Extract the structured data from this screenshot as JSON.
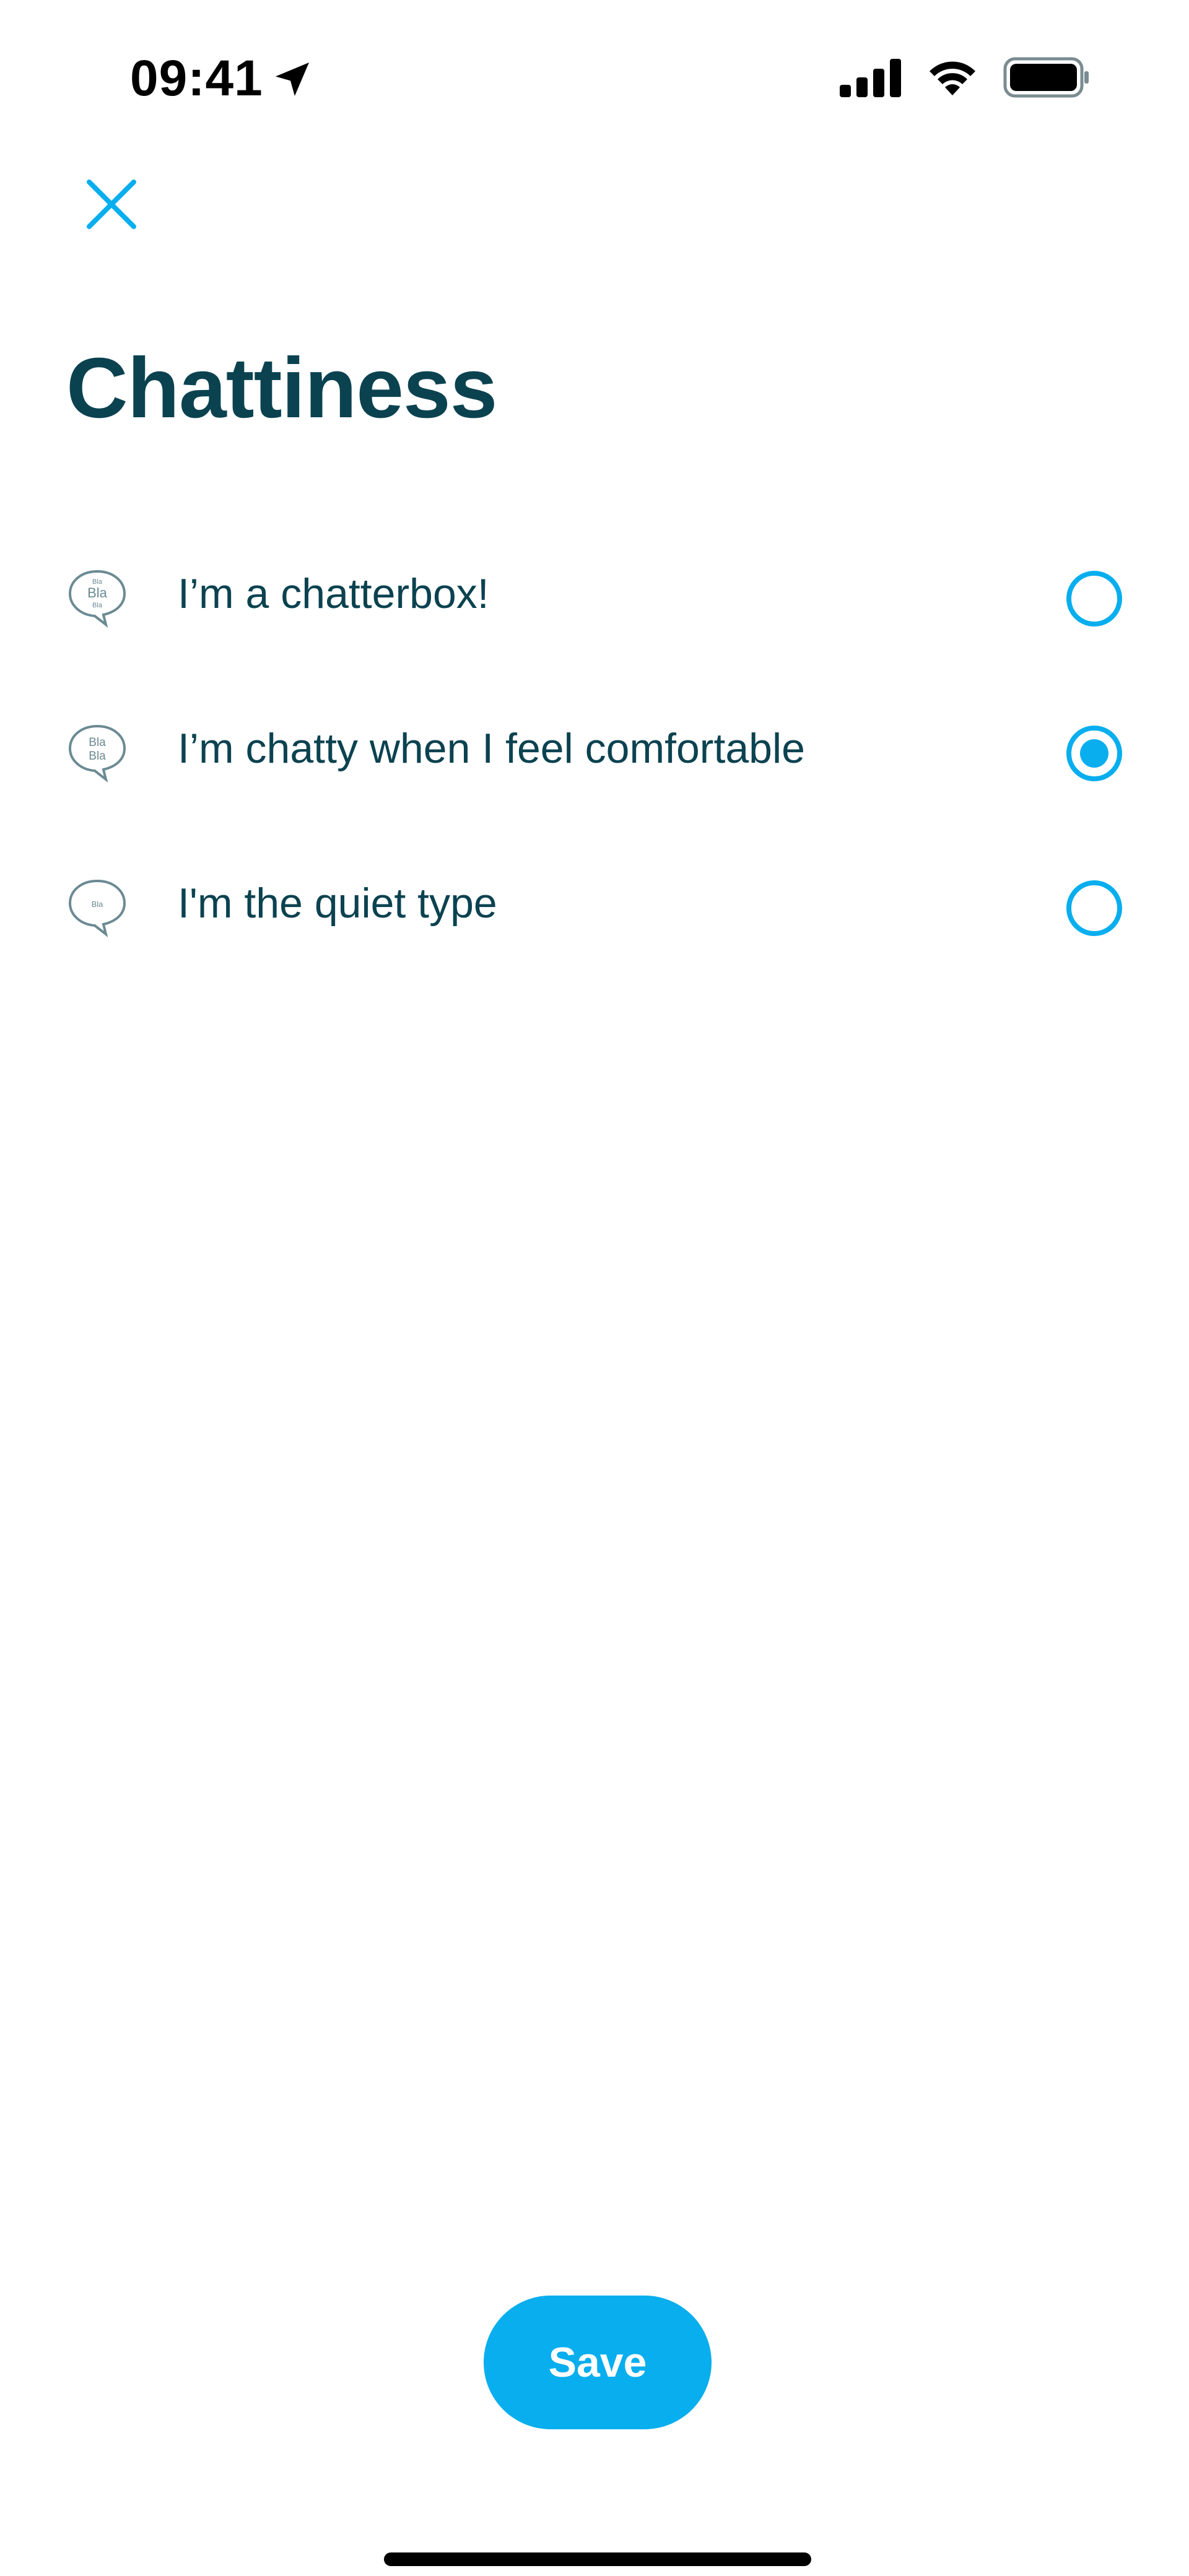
{
  "status_bar": {
    "time": "09:41",
    "icons": [
      "location-arrow-icon",
      "cellular-signal-icon",
      "wifi-icon",
      "battery-icon"
    ]
  },
  "header": {
    "close_icon": "close-icon",
    "title": "Chattiness"
  },
  "options": [
    {
      "label": "I’m a chatterbox!",
      "icon": "speech-bubble-bla-bla-bla-icon",
      "selected": false
    },
    {
      "label": "I’m chatty when I feel comfortable",
      "icon": "speech-bubble-bla-bla-icon",
      "selected": true
    },
    {
      "label": "I'm the quiet type",
      "icon": "speech-bubble-bla-icon",
      "selected": false
    }
  ],
  "footer": {
    "save_label": "Save"
  },
  "colors": {
    "accent": "#08aeee",
    "text": "#0b4250",
    "icon": "#6b8a93"
  }
}
